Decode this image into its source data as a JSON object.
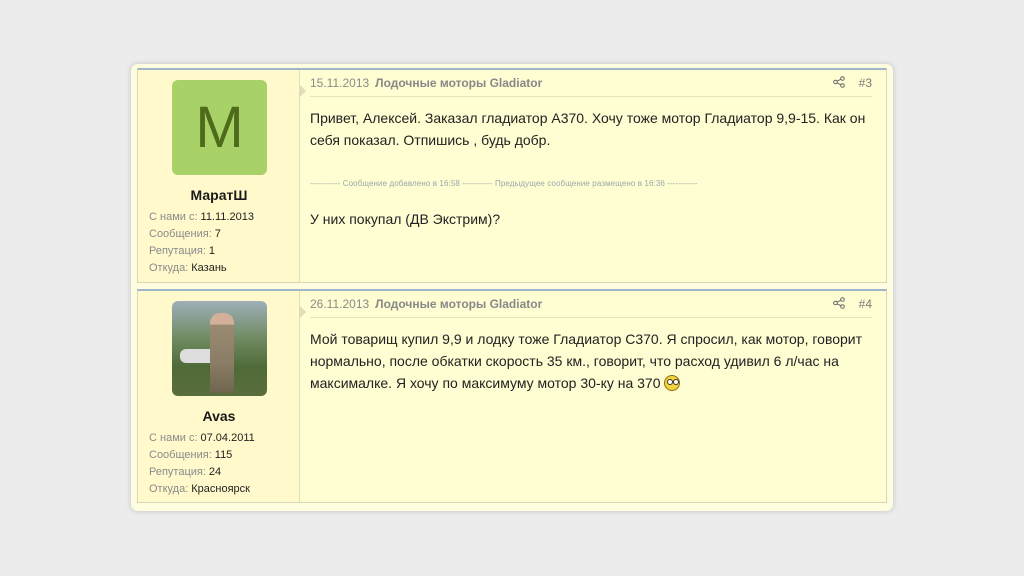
{
  "posts": [
    {
      "user": {
        "avatar_letter": "M",
        "name": "МаратШ",
        "stats": [
          {
            "k": "С нами с:",
            "v": "11.11.2013"
          },
          {
            "k": "Сообщения:",
            "v": "7"
          },
          {
            "k": "Репутация:",
            "v": "1"
          },
          {
            "k": "Откуда:",
            "v": "Казань"
          }
        ]
      },
      "date": "15.11.2013",
      "forum": "Лодочные моторы Gladiator",
      "share_icon": "share-icon",
      "number": "#3",
      "text1": "Привет, Алексей. Заказал гладиатор А370. Хочу тоже мотор Гладиатор 9,9-15. Как он себя показал. Отпишись , будь добр.",
      "merged_note": "----------- Сообщение добавлено в 16:58 ----------- Предыдущее сообщение размещено в 16:36 -----------",
      "text2": "У них покупал (ДВ Экстрим)?"
    },
    {
      "user": {
        "avatar_image": "user-photo",
        "name": "Avas",
        "stats": [
          {
            "k": "С нами с:",
            "v": "07.04.2011"
          },
          {
            "k": "Сообщения:",
            "v": "115"
          },
          {
            "k": "Репутация:",
            "v": "24"
          },
          {
            "k": "Откуда:",
            "v": "Красноярск"
          }
        ]
      },
      "date": "26.11.2013",
      "forum": "Лодочные моторы Gladiator",
      "share_icon": "share-icon",
      "number": "#4",
      "text1": "Мой товарищ купил 9,9 и лодку тоже Гладиатор С370. Я спросил, как мотор, говорит нормально, после обкатки скорость 35 км., говорит, что расход удивил 6 л/час на максималке. Я хочу по максимуму мотор 30-ку на 370",
      "emoji": "shocked-smiley"
    }
  ]
}
